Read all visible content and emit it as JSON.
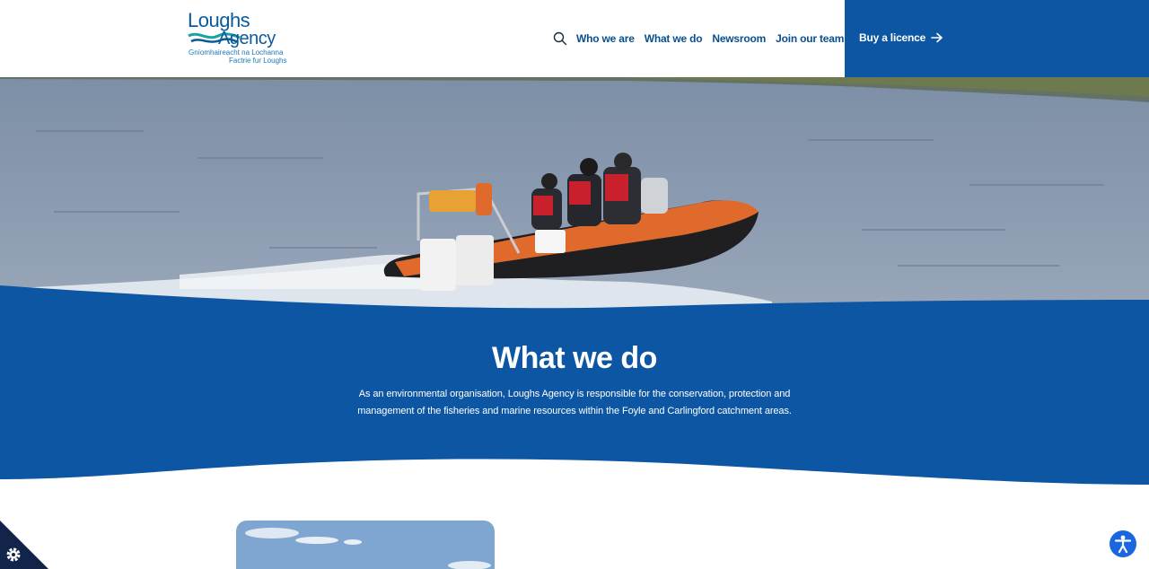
{
  "brand": {
    "name_line1": "Loughs",
    "name_line2": "Agency",
    "irish": "Gníomhaireacht na Lochanna",
    "ulster_scots": "Factrie fur Loughs",
    "color_primary": "#0d56a4",
    "color_text": "#0a4f8f"
  },
  "nav": {
    "items": [
      {
        "label": "Who we are"
      },
      {
        "label": "What we do"
      },
      {
        "label": "Newsroom"
      },
      {
        "label": "Join our team"
      }
    ],
    "search_icon": "search-icon",
    "cta_label": "Buy a licence",
    "cta_icon": "arrow-right-icon"
  },
  "section": {
    "title": "What we do",
    "body": "As an environmental organisation, Loughs Agency is responsible for the conservation, protection and management of the fisheries and marine resources within the Foyle and Carlingford catchment areas."
  },
  "widgets": {
    "cookie_icon": "gear-icon",
    "accessibility_icon": "accessibility-icon"
  }
}
